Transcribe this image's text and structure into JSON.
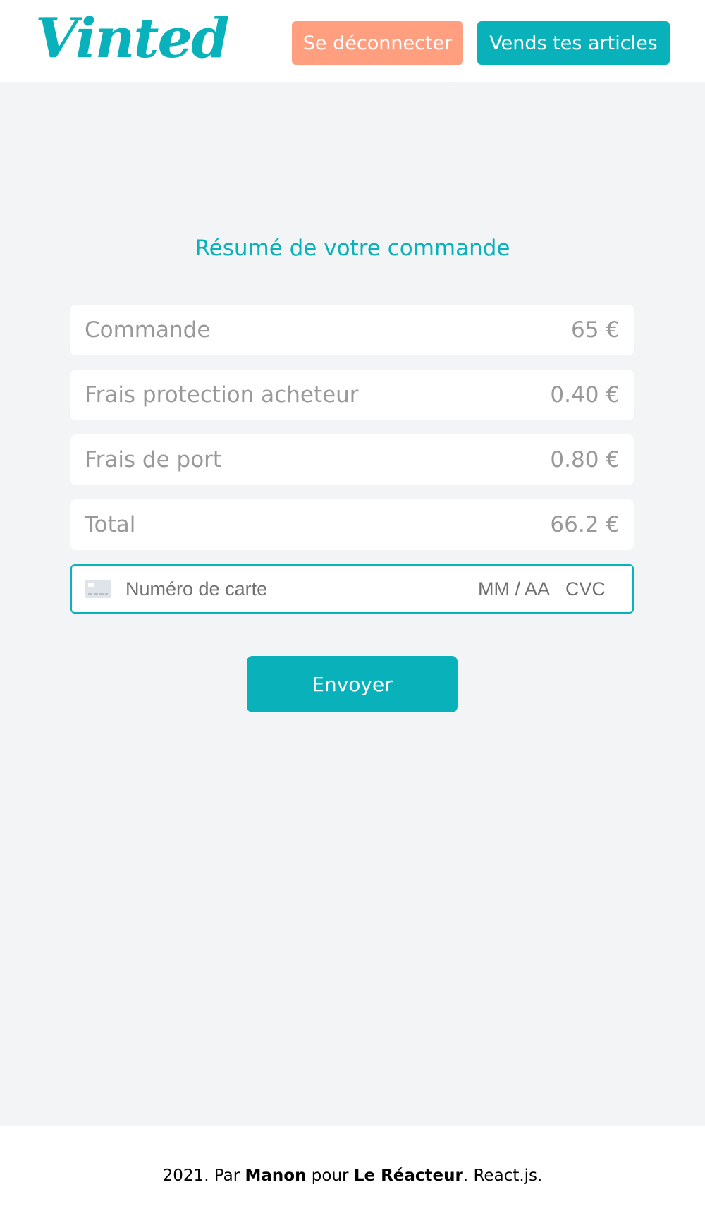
{
  "header": {
    "logo_text": "Vinted",
    "logout_label": "Se déconnecter",
    "sell_label": "Vends tes articles"
  },
  "summary": {
    "title": "Résumé de votre commande",
    "rows": [
      {
        "label": "Commande",
        "value": "65 €"
      },
      {
        "label": "Frais protection acheteur",
        "value": "0.40 €"
      },
      {
        "label": "Frais de port",
        "value": "0.80 €"
      },
      {
        "label": "Total",
        "value": "66.2 €"
      }
    ]
  },
  "card": {
    "number_placeholder": "Numéro de carte",
    "expiry_placeholder": "MM / AA",
    "cvc_placeholder": "CVC",
    "icon": "credit-card-icon"
  },
  "submit_label": "Envoyer",
  "footer": {
    "prefix": "2021. Par ",
    "author": "Manon",
    "middle": " pour ",
    "school": "Le Réacteur",
    "suffix": ". React.js."
  },
  "colors": {
    "accent": "#09b1ba",
    "logout": "#ff9f7f",
    "background": "#f3f4f6",
    "muted_text": "#999999"
  }
}
